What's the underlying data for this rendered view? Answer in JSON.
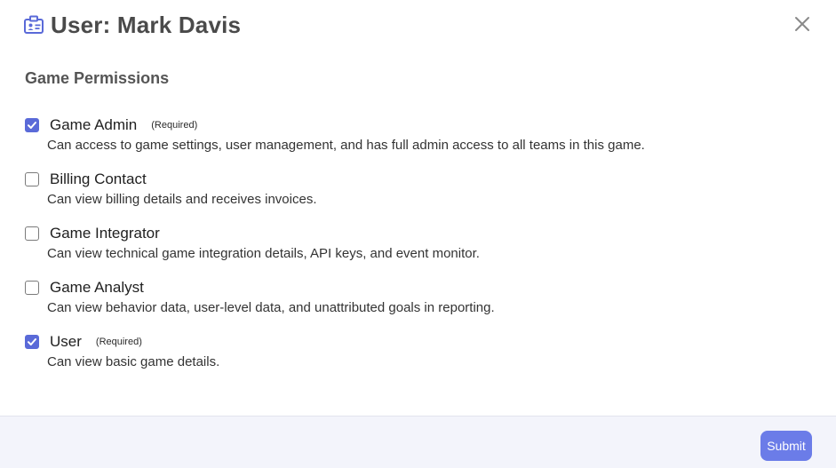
{
  "header": {
    "title": "User: Mark Davis",
    "icon": "id-card-icon"
  },
  "close": {
    "icon": "close-icon"
  },
  "section": {
    "title": "Game Permissions"
  },
  "permissions": [
    {
      "label": "Game Admin",
      "required": "(Required)",
      "checked": true,
      "description": "Can access to game settings, user management, and has full admin access to all teams in this game."
    },
    {
      "label": "Billing Contact",
      "required": "",
      "checked": false,
      "description": "Can view billing details and receives invoices."
    },
    {
      "label": "Game Integrator",
      "required": "",
      "checked": false,
      "description": "Can view technical game integration details, API keys, and event monitor."
    },
    {
      "label": "Game Analyst",
      "required": "",
      "checked": false,
      "description": "Can view behavior data, user-level data, and unattributed goals in reporting."
    },
    {
      "label": "User",
      "required": "(Required)",
      "checked": true,
      "description": "Can view basic game details."
    }
  ],
  "footer": {
    "submit_label": "Submit"
  },
  "colors": {
    "accent": "#5a6ad8",
    "submit": "#6b7ce8",
    "footer_bg": "#f3f4fb"
  }
}
